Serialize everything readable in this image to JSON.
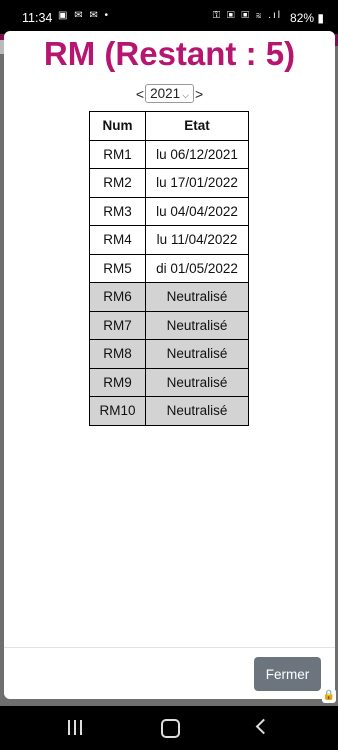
{
  "status_bar": {
    "time": "11:34",
    "left_icons": "▣ ✉ ✉ •",
    "right_icons": "⚿ ▣ ▣ ≋ .ıl",
    "battery": "82%"
  },
  "modal": {
    "title": "RM (Restant : 5)",
    "year_nav": {
      "prev": "<",
      "next": ">",
      "selected_year": "2021"
    },
    "table": {
      "headers": [
        "Num",
        "Etat"
      ],
      "rows": [
        {
          "num": "RM1",
          "etat": "lu 06/12/2021"
        },
        {
          "num": "RM2",
          "etat": "lu 17/01/2022"
        },
        {
          "num": "RM3",
          "etat": "lu 04/04/2022"
        },
        {
          "num": "RM4",
          "etat": "lu 11/04/2022"
        },
        {
          "num": "RM5",
          "etat": "di 01/05/2022"
        },
        {
          "num": "RM6",
          "etat": "Neutralisé"
        },
        {
          "num": "RM7",
          "etat": "Neutralisé"
        },
        {
          "num": "RM8",
          "etat": "Neutralisé"
        },
        {
          "num": "RM9",
          "etat": "Neutralisé"
        },
        {
          "num": "RM10",
          "etat": "Neutralisé"
        }
      ]
    },
    "close_label": "Fermer"
  },
  "colors": {
    "title": "#b6166f",
    "neutral_row": "#d3d3d3",
    "close_button": "#6c757d"
  }
}
